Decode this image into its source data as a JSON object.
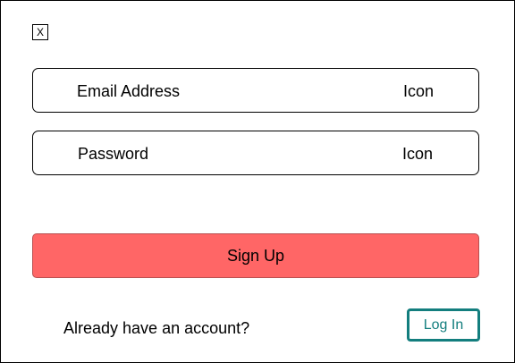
{
  "dialog": {
    "close_label": "X"
  },
  "form": {
    "email": {
      "label": "Email Address",
      "icon_label": "Icon"
    },
    "password": {
      "label": "Password",
      "icon_label": "Icon"
    },
    "signup_label": "Sign Up"
  },
  "footer": {
    "account_prompt": "Already have an account?",
    "login_label": "Log In"
  },
  "colors": {
    "signup_button": "#ff6666",
    "login_accent": "#137e7e",
    "border": "#000000"
  }
}
